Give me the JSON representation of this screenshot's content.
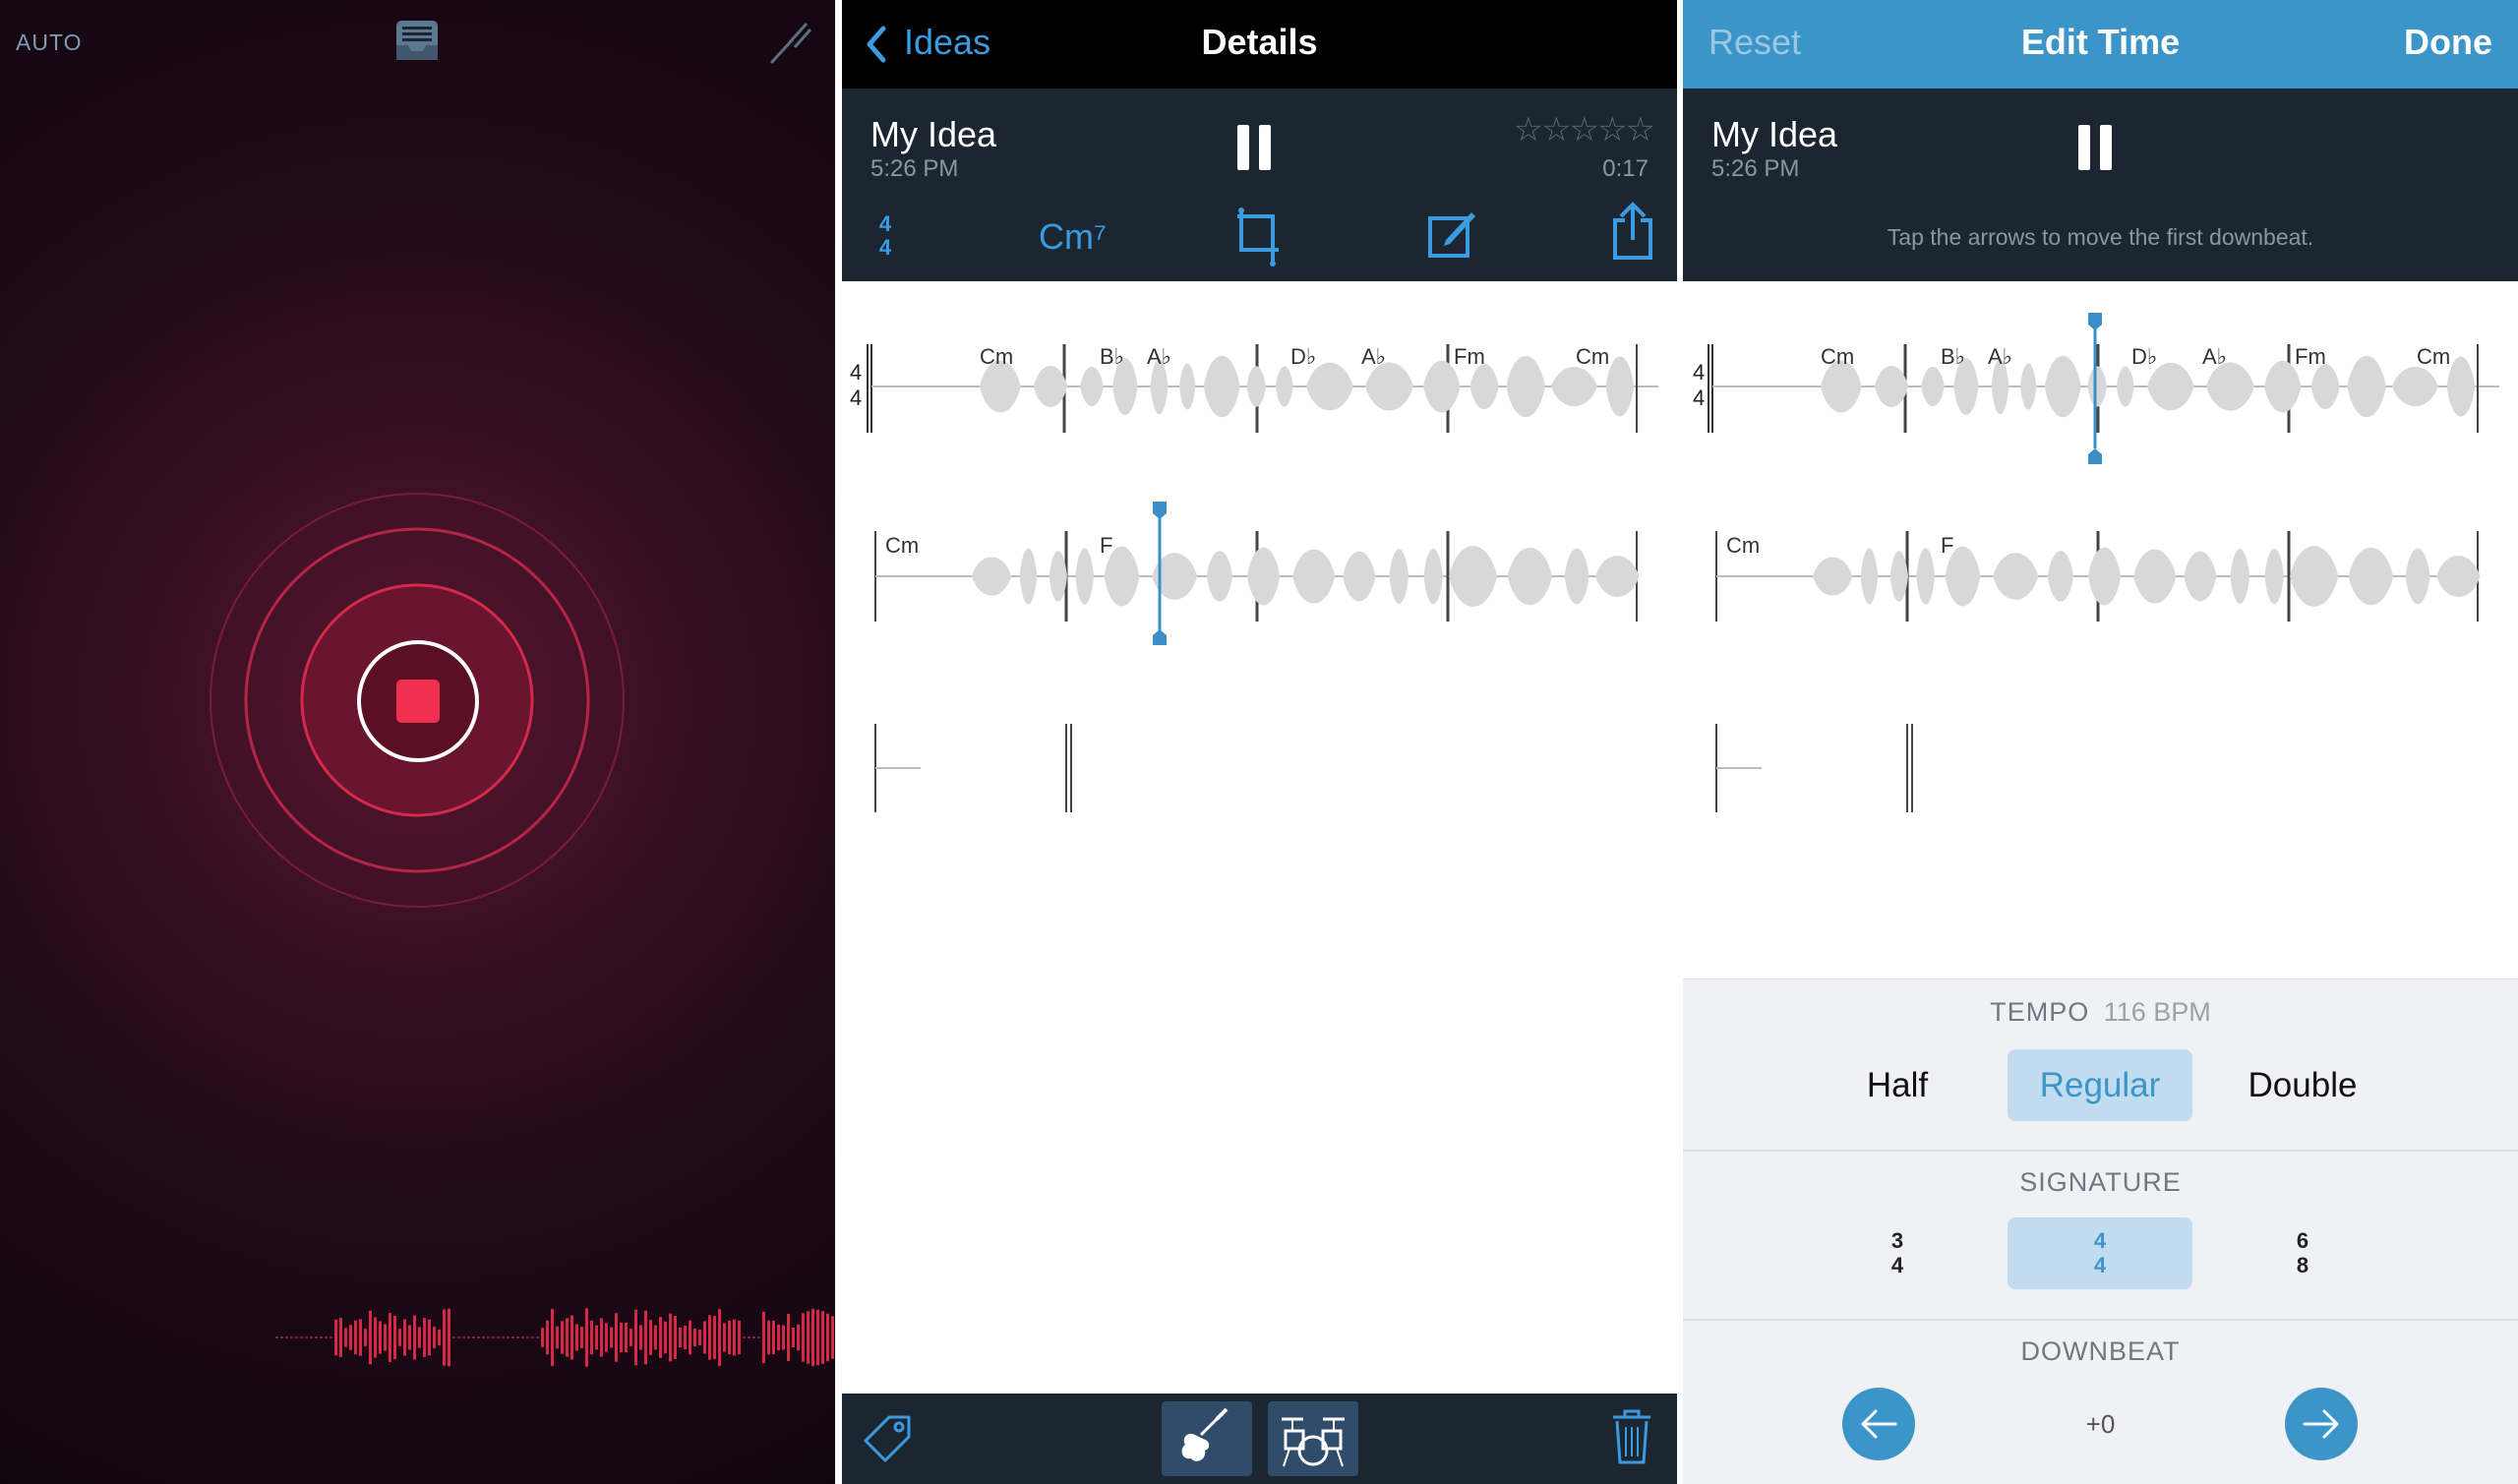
{
  "recorder": {
    "auto_label": "AUTO",
    "icons": [
      "inbox-tray-icon",
      "tuning-fork-icon",
      "stop-record-icon"
    ],
    "accent": "#f0304e"
  },
  "details": {
    "back_label": "Ideas",
    "title": "Details",
    "idea_name": "My Idea",
    "idea_time": "5:26 PM",
    "duration": "0:17",
    "rating": "☆☆☆☆☆",
    "time_signature": {
      "top": "4",
      "bottom": "4"
    },
    "key": "Cm⁷",
    "staff_sig": {
      "top": "4",
      "bottom": "4"
    },
    "row1_chords": [
      "Cm",
      "B♭",
      "A♭",
      "D♭",
      "A♭",
      "Fm",
      "Cm"
    ],
    "row2_chords": [
      "Cm",
      "F"
    ],
    "bottom_icons": [
      "tag-icon",
      "guitar-icon",
      "drums-icon",
      "trash-icon"
    ]
  },
  "edit_time": {
    "reset_label": "Reset",
    "title": "Edit Time",
    "done_label": "Done",
    "idea_name": "My Idea",
    "idea_time": "5:26 PM",
    "hint": "Tap the arrows to move the first downbeat.",
    "staff_sig": {
      "top": "4",
      "bottom": "4"
    },
    "row1_chords": [
      "Cm",
      "B♭",
      "A♭",
      "D♭",
      "A♭",
      "Fm",
      "Cm"
    ],
    "row2_chords": [
      "Cm",
      "F"
    ],
    "tempo_label": "TEMPO",
    "tempo_value": "116 BPM",
    "tempo_options": [
      "Half",
      "Regular",
      "Double"
    ],
    "tempo_selected": "Regular",
    "signature_label": "SIGNATURE",
    "signatures": [
      {
        "top": "3",
        "bottom": "4"
      },
      {
        "top": "4",
        "bottom": "4"
      },
      {
        "top": "6",
        "bottom": "8"
      }
    ],
    "signature_selected_index": 1,
    "downbeat_label": "DOWNBEAT",
    "downbeat_value": "+0",
    "accent": "#3b95c9"
  }
}
